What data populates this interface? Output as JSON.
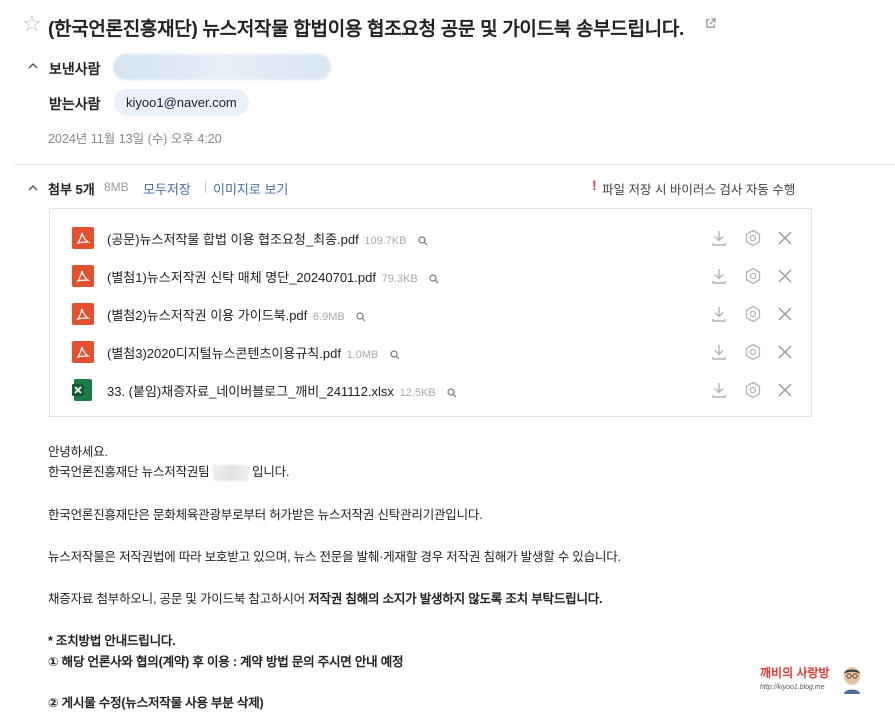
{
  "email": {
    "subject": "(한국언론진흥재단) 뉴스저작물 합법이용 협조요청 공문 및 가이드북 송부드립니다.",
    "sender_label": "보낸사람",
    "recipient_label": "받는사람",
    "recipient": "kiyoo1@naver.com",
    "date": "2024년 11월 13일 (수) 오후 4:20"
  },
  "attachments": {
    "title": "첨부 5개",
    "total_size": "8MB",
    "save_all": "모두저장",
    "view_as_image": "이미지로 보기",
    "warning_mark": "!",
    "warning": "파일 저장 시 바이러스 검사 자동 수행",
    "files": [
      {
        "name": "(공문)뉴스저작물 합법 이용 협조요청_최종.pdf",
        "size": "109.7KB",
        "type": "pdf"
      },
      {
        "name": "(별첨1)뉴스저작권 신탁 매체 명단_20240701.pdf",
        "size": "79.3KB",
        "type": "pdf"
      },
      {
        "name": "(별첨2)뉴스저작권 이용 가이드북.pdf",
        "size": "6.9MB",
        "type": "pdf"
      },
      {
        "name": "(별첨3)2020디지털뉴스콘텐츠이용규칙.pdf",
        "size": "1.0MB",
        "type": "pdf"
      },
      {
        "name": "33. (붙임)채증자료_네이버블로그_깨비_241112.xlsx",
        "size": "12.5KB",
        "type": "xlsx"
      }
    ]
  },
  "body": {
    "greeting": "안녕하세요.",
    "intro_a": "한국언론진흥재단 뉴스저작권팀",
    "intro_b": "입니다.",
    "p1": "한국언론진흥재단은 문화체육관광부로부터 허가받은 뉴스저작권 신탁관리기관입니다.",
    "p2": "뉴스저작물은 저작권법에 따라 보호받고 있으며, 뉴스 전문을 발췌·게재할 경우 저작권 침해가 발생할 수 있습니다.",
    "p3_a": "채증자료 첨부하오니, 공문 및 가이드북 참고하시어 ",
    "p3_b": "저작권 침해의 소지가 발생하지 않도록 조치 부탁드립니다.",
    "method_title": "* 조치방법 안내드립니다.",
    "method_1": "① 해당 언론사와 협의(계약) 후 이용 : 계약 방법 문의 주시면 안내 예정",
    "method_2": "② 게시물 수정(뉴스저작물 사용 부분 삭제)"
  },
  "watermark": {
    "title": "깨비의 사랑방",
    "url": "http://kiyoo1.blog.me"
  },
  "colors": {
    "link": "#4a6fa5",
    "warning": "#e53935",
    "pdf": "#e2502e",
    "xlsx": "#1d7a45",
    "recipient_pill": "#eaf1fb"
  }
}
